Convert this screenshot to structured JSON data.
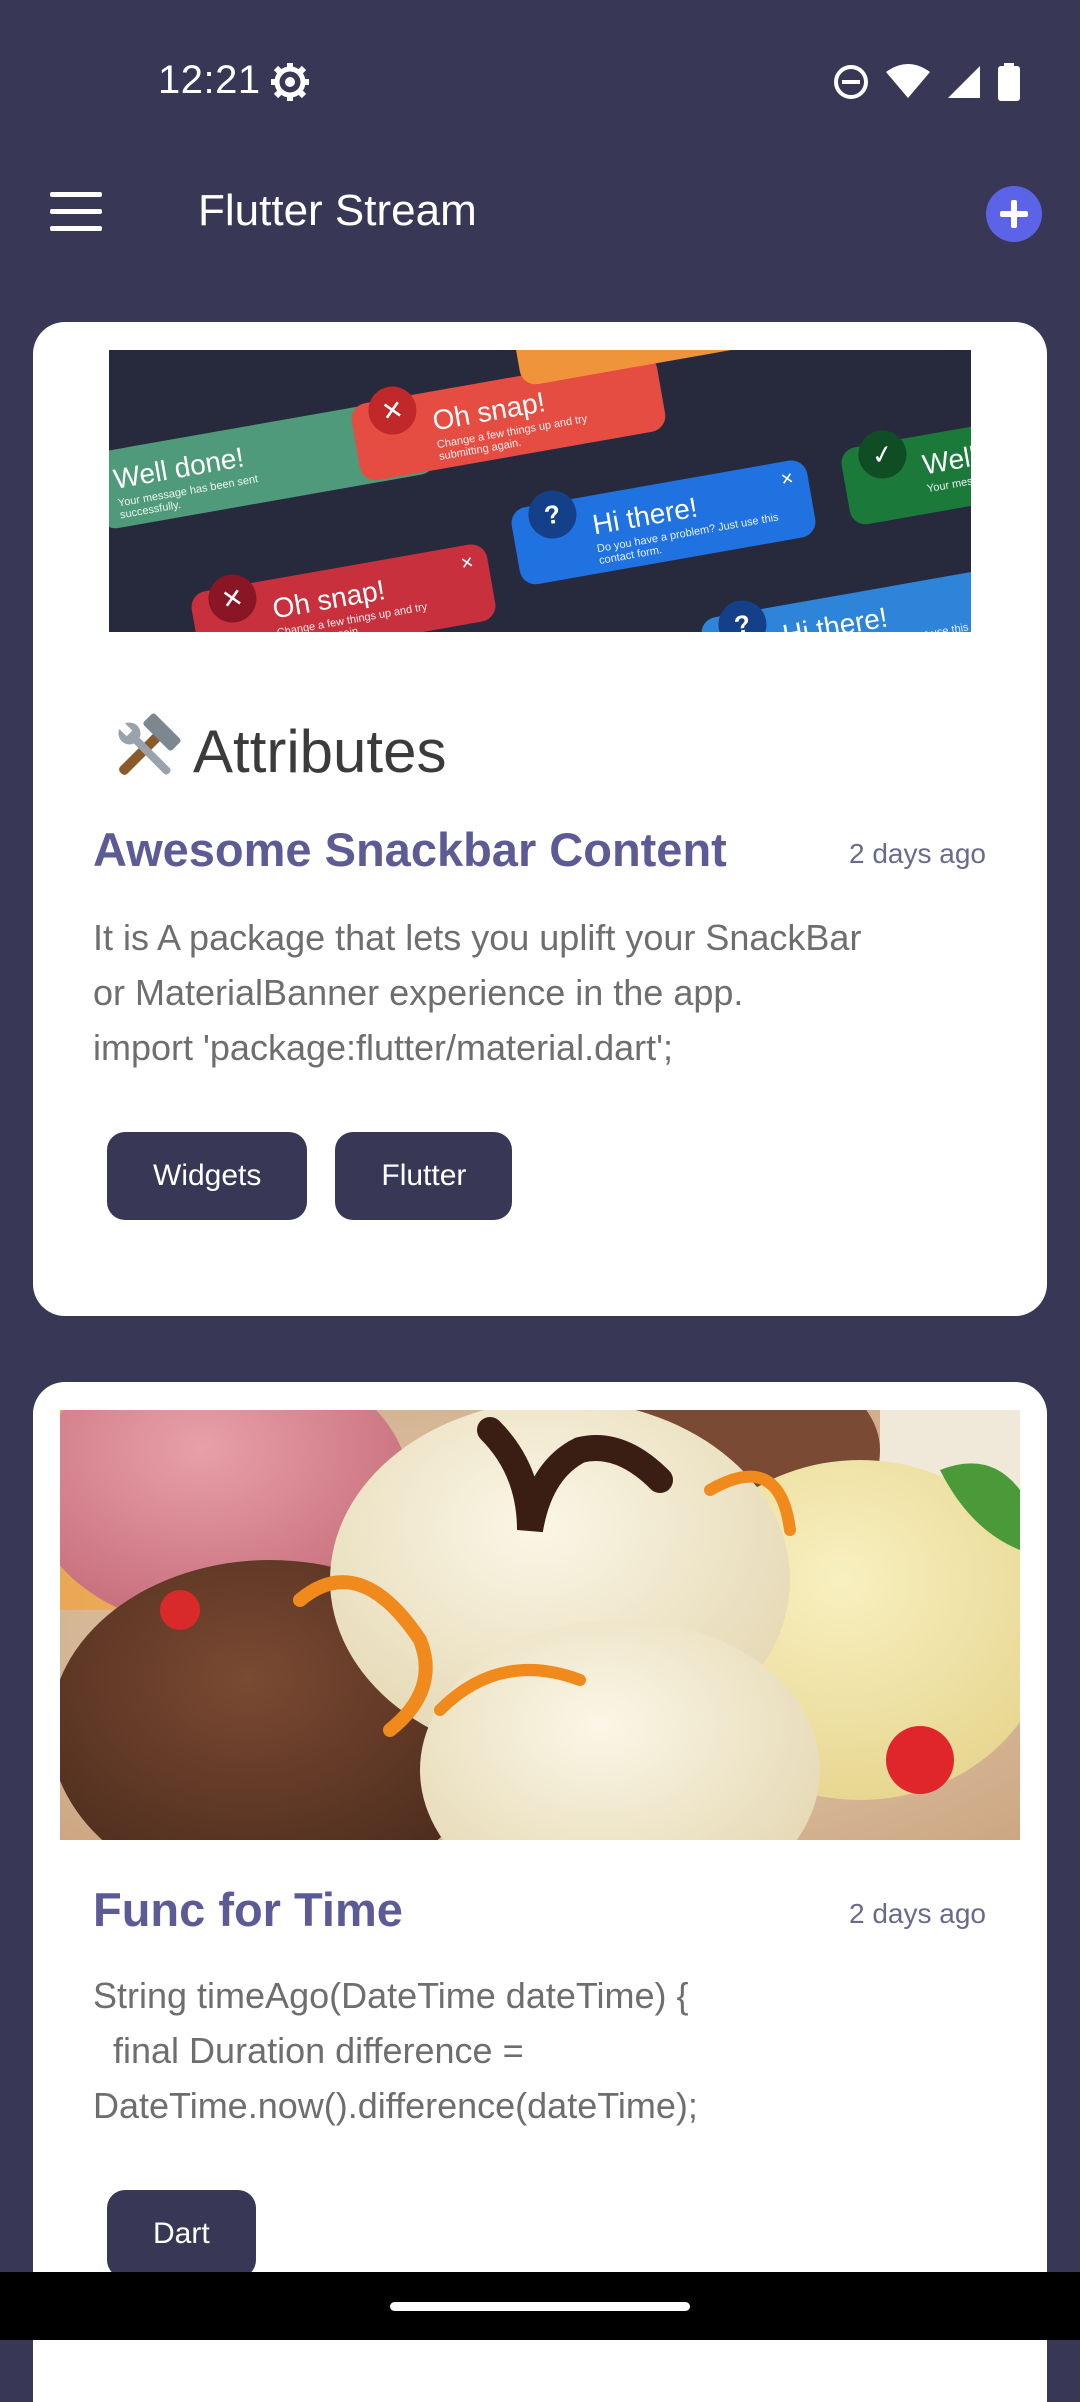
{
  "status_bar": {
    "time": "12:21"
  },
  "app_bar": {
    "title": "Flutter Stream"
  },
  "posts": [
    {
      "banner": {
        "snackbars": [
          {
            "title": "Well done!",
            "subtitle": "Your message has been sent successfully."
          },
          {
            "title": "Oh snap!",
            "subtitle": "Change a few things up and try submitting again."
          },
          {
            "title": "Hi there!",
            "subtitle": "Do you have a problem? Just use this contact form."
          },
          {
            "title": "Oh snap!",
            "subtitle": "Change a few things up and try submitting again."
          },
          {
            "title": "Hi there!",
            "subtitle": "Do you have a problem? Just use this contact form."
          },
          {
            "title": "Well",
            "subtitle": "Your mes succes"
          }
        ]
      },
      "heading": "Attributes",
      "title": "Awesome Snackbar Content",
      "date": "2 days ago",
      "body": "It is A package that lets you uplift your SnackBar\nor MaterialBanner experience in the app.\nimport 'package:flutter/material.dart';",
      "tags": [
        "Widgets",
        "Flutter"
      ]
    },
    {
      "title": "Func for Time",
      "date": "2 days ago",
      "body": "String timeAgo(DateTime dateTime) {\n  final Duration difference =\nDateTime.now().difference(dateTime);",
      "tags": [
        "Dart"
      ]
    }
  ],
  "colors": {
    "background": "#383856",
    "card": "#ffffff",
    "title": "#5d5b96",
    "tag_bg": "#383856",
    "fab": "#5c63e6"
  }
}
